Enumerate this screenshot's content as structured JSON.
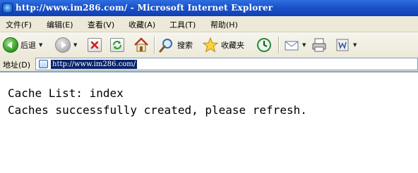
{
  "window": {
    "title": "http://www.im286.com/ - Microsoft Internet Explorer"
  },
  "menu": {
    "items": [
      {
        "label": "文件(F)"
      },
      {
        "label": "编辑(E)"
      },
      {
        "label": "查看(V)"
      },
      {
        "label": "收藏(A)"
      },
      {
        "label": "工具(T)"
      },
      {
        "label": "帮助(H)"
      }
    ]
  },
  "toolbar": {
    "back_label": "后退",
    "search_label": "搜索",
    "favorites_label": "收藏夹",
    "icons": [
      "back-icon",
      "forward-icon",
      "stop-icon",
      "refresh-icon",
      "home-icon",
      "search-icon",
      "favorites-star-icon",
      "history-icon",
      "mail-icon",
      "print-icon",
      "edit-icon"
    ]
  },
  "address": {
    "label": "地址(D)",
    "value": "http://www.im286.com/"
  },
  "content": {
    "lines": [
      "Cache List: index",
      "Caches successfully created, please refresh."
    ]
  },
  "colors": {
    "titlebar": "#1b52c9",
    "chrome": "#ece9d8",
    "address_selection": "#0a246a"
  }
}
